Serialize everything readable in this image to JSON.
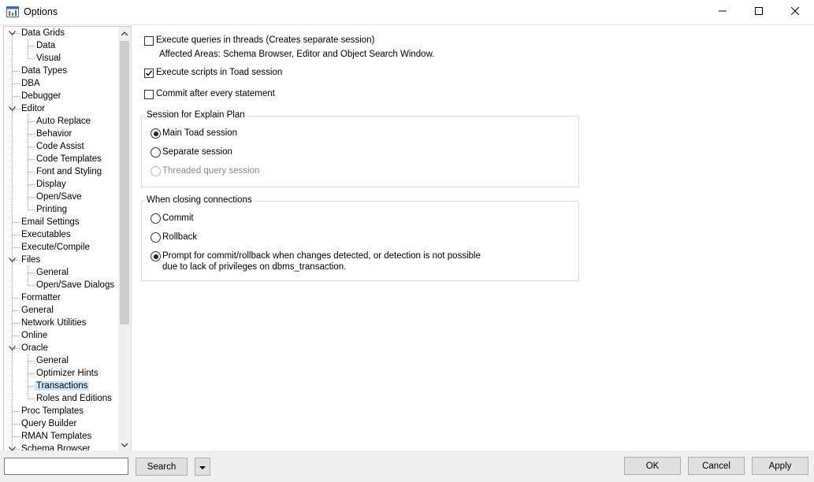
{
  "window": {
    "title": "Options"
  },
  "tree": {
    "items": [
      {
        "label": "Data Grids",
        "level": 0,
        "expander": "expanded"
      },
      {
        "label": "Data",
        "level": 1
      },
      {
        "label": "Visual",
        "level": 1
      },
      {
        "label": "Data Types",
        "level": 0
      },
      {
        "label": "DBA",
        "level": 0
      },
      {
        "label": "Debugger",
        "level": 0
      },
      {
        "label": "Editor",
        "level": 0,
        "expander": "expanded"
      },
      {
        "label": "Auto Replace",
        "level": 1
      },
      {
        "label": "Behavior",
        "level": 1
      },
      {
        "label": "Code Assist",
        "level": 1
      },
      {
        "label": "Code Templates",
        "level": 1
      },
      {
        "label": "Font and Styling",
        "level": 1
      },
      {
        "label": "Display",
        "level": 1
      },
      {
        "label": "Open/Save",
        "level": 1
      },
      {
        "label": "Printing",
        "level": 1
      },
      {
        "label": "Email Settings",
        "level": 0
      },
      {
        "label": "Executables",
        "level": 0
      },
      {
        "label": "Execute/Compile",
        "level": 0
      },
      {
        "label": "Files",
        "level": 0,
        "expander": "expanded"
      },
      {
        "label": "General",
        "level": 1
      },
      {
        "label": "Open/Save Dialogs",
        "level": 1
      },
      {
        "label": "Formatter",
        "level": 0
      },
      {
        "label": "General",
        "level": 0
      },
      {
        "label": "Network Utilities",
        "level": 0
      },
      {
        "label": "Online",
        "level": 0
      },
      {
        "label": "Oracle",
        "level": 0,
        "expander": "expanded"
      },
      {
        "label": "General",
        "level": 1
      },
      {
        "label": "Optimizer Hints",
        "level": 1
      },
      {
        "label": "Transactions",
        "level": 1,
        "selected": true
      },
      {
        "label": "Roles and Editions",
        "level": 1
      },
      {
        "label": "Proc Templates",
        "level": 0
      },
      {
        "label": "Query Builder",
        "level": 0
      },
      {
        "label": "RMAN Templates",
        "level": 0
      },
      {
        "label": "Schema Browser",
        "level": 0,
        "expander": "expanded"
      }
    ]
  },
  "options": {
    "threads_checkbox": {
      "label": "Execute queries in threads (Creates separate session)",
      "checked": false
    },
    "threads_note": "Affected Areas: Schema Browser, Editor and Object Search Window.",
    "scripts_checkbox": {
      "label": "Execute scripts in Toad session",
      "checked": true
    },
    "commit_checkbox": {
      "label": "Commit after every statement",
      "checked": false
    },
    "explain_group": {
      "title": "Session for Explain Plan",
      "options": [
        {
          "label": "Main Toad session",
          "selected": true,
          "enabled": true
        },
        {
          "label": "Separate session",
          "selected": false,
          "enabled": true
        },
        {
          "label": "Threaded query session",
          "selected": false,
          "enabled": false
        }
      ]
    },
    "closing_group": {
      "title": "When closing connections",
      "options": [
        {
          "label": "Commit",
          "selected": false
        },
        {
          "label": "Rollback",
          "selected": false
        },
        {
          "label": "Prompt for commit/rollback when changes detected, or detection is not possible",
          "label2": "due to lack of privileges on dbms_transaction.",
          "selected": true
        }
      ]
    }
  },
  "bottom": {
    "search_value": "",
    "search_button": "Search",
    "ok_button": "OK",
    "cancel_button": "Cancel",
    "apply_button": "Apply"
  },
  "colors": {
    "selection": "#cce8ff",
    "border": "#c8c8c8",
    "button_face": "#e1e1e1"
  }
}
